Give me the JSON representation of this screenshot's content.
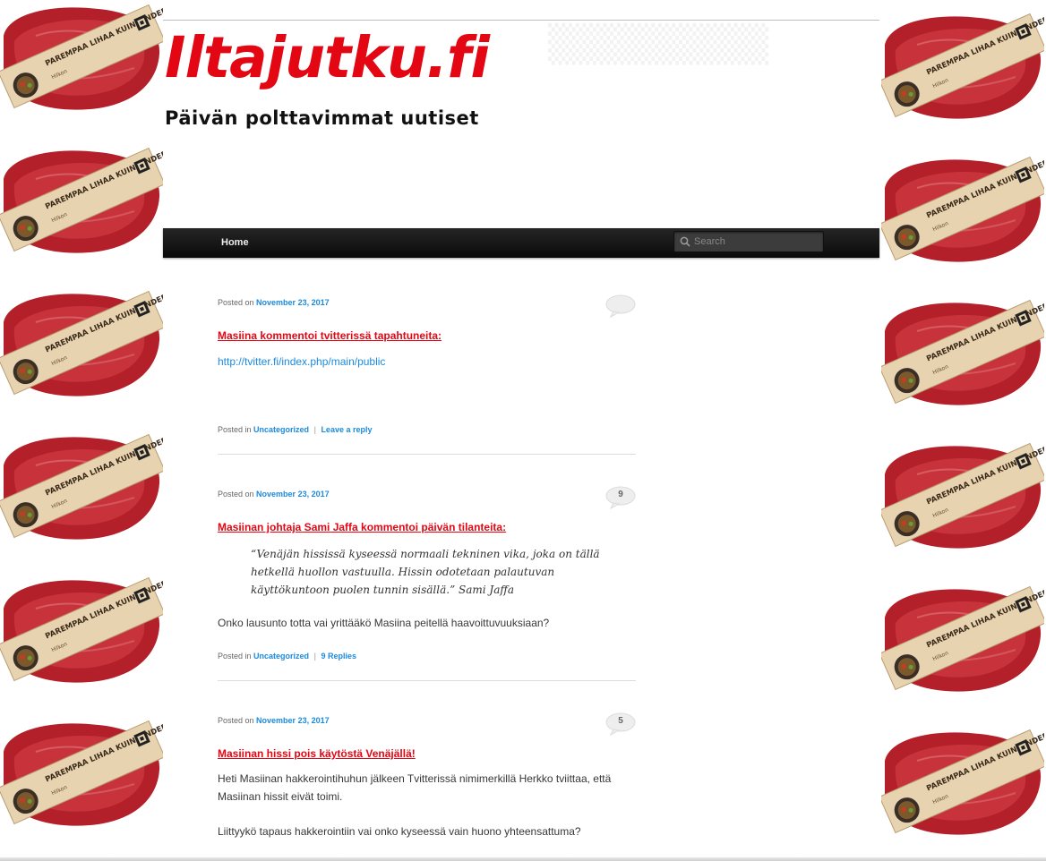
{
  "site": {
    "title": "Iltajutku.fi",
    "description": "Päivän polttavimmat uutiset"
  },
  "nav": {
    "home_label": "Home",
    "search_placeholder": "Search"
  },
  "ads": {
    "banner_text": "PAREMPAA LIHAA KUIN TINDERISSÄ",
    "brand_text": "Hilkon"
  },
  "posts": [
    {
      "posted_on_label": "Posted on",
      "date": "November 23, 2017",
      "title": "Masiina kommentoi tvitterissä tapahtuneita:",
      "link": "http://tvitter.fi/index.php/main/public",
      "comment_count": "",
      "footer": {
        "posted_in_label": "Posted in",
        "category": "Uncategorized",
        "reply_link": "Leave a reply"
      }
    },
    {
      "posted_on_label": "Posted on",
      "date": "November 23, 2017",
      "title": "Masiinan johtaja Sami Jaffa kommentoi päivän tilanteita:",
      "quote": "“Venäjän hississä kyseessä normaali tekninen vika, joka on tällä hetkellä huollon vastuulla. Hissin odotetaan palautuvan käyttökuntoon puolen tunnin sisällä.” Sami Jaffa",
      "body": "Onko lausunto totta vai yrittääkö Masiina peitellä haavoittuvuuksiaan?",
      "comment_count": "9",
      "footer": {
        "posted_in_label": "Posted in",
        "category": "Uncategorized",
        "reply_link": "9 Replies"
      }
    },
    {
      "posted_on_label": "Posted on",
      "date": "November 23, 2017",
      "title": "Masiinan hissi pois käytöstä Venäjällä!",
      "body": "Heti Masiinan hakkerointihuhun jälkeen Tvitterissä nimimerkillä Herkko tviittaa, että Masiinan hissit eivät toimi.",
      "body2": "Liittyykö tapaus hakkerointiin vai onko kyseessä vain huono yhteensattuma?",
      "comment_count": "5"
    }
  ],
  "colors": {
    "title_red": "#e30613",
    "link_blue": "#1b8be0",
    "nav_dark": "#1a1a1a"
  }
}
